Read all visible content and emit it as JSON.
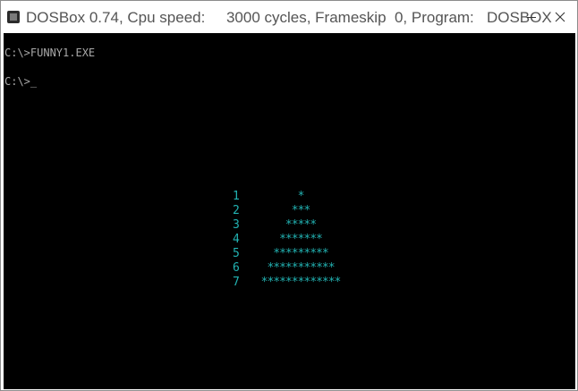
{
  "window": {
    "title": "DOSBox 0.74, Cpu speed:     3000 cycles, Frameskip  0, Program:   DOSBOX"
  },
  "console": {
    "lines": [
      "C:\\>FUNNY1.EXE",
      "",
      "C:\\>"
    ],
    "cursor": "_"
  },
  "pyramid": {
    "rows": [
      {
        "num": "1",
        "stars": "*"
      },
      {
        "num": "2",
        "stars": "***"
      },
      {
        "num": "3",
        "stars": "*****"
      },
      {
        "num": "4",
        "stars": "*******"
      },
      {
        "num": "5",
        "stars": "*********"
      },
      {
        "num": "6",
        "stars": "***********"
      },
      {
        "num": "7",
        "stars": "*************"
      }
    ]
  },
  "colors": {
    "console_text": "#a8a8a8",
    "pyramid_text": "#22b2b2",
    "screen_bg": "#000000"
  },
  "icons": {
    "app": "dosbox-app-icon",
    "minimize": "minimize-icon",
    "close": "close-icon"
  }
}
